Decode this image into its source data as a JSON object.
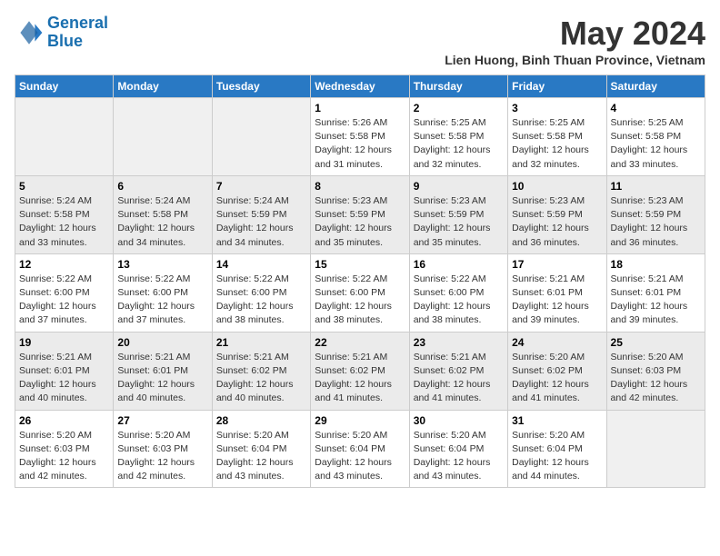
{
  "header": {
    "logo_line1": "General",
    "logo_line2": "Blue",
    "month_title": "May 2024",
    "subtitle": "Lien Huong, Binh Thuan Province, Vietnam"
  },
  "weekdays": [
    "Sunday",
    "Monday",
    "Tuesday",
    "Wednesday",
    "Thursday",
    "Friday",
    "Saturday"
  ],
  "weeks": [
    [
      {
        "day": "",
        "info": ""
      },
      {
        "day": "",
        "info": ""
      },
      {
        "day": "",
        "info": ""
      },
      {
        "day": "1",
        "info": "Sunrise: 5:26 AM\nSunset: 5:58 PM\nDaylight: 12 hours\nand 31 minutes."
      },
      {
        "day": "2",
        "info": "Sunrise: 5:25 AM\nSunset: 5:58 PM\nDaylight: 12 hours\nand 32 minutes."
      },
      {
        "day": "3",
        "info": "Sunrise: 5:25 AM\nSunset: 5:58 PM\nDaylight: 12 hours\nand 32 minutes."
      },
      {
        "day": "4",
        "info": "Sunrise: 5:25 AM\nSunset: 5:58 PM\nDaylight: 12 hours\nand 33 minutes."
      }
    ],
    [
      {
        "day": "5",
        "info": "Sunrise: 5:24 AM\nSunset: 5:58 PM\nDaylight: 12 hours\nand 33 minutes."
      },
      {
        "day": "6",
        "info": "Sunrise: 5:24 AM\nSunset: 5:58 PM\nDaylight: 12 hours\nand 34 minutes."
      },
      {
        "day": "7",
        "info": "Sunrise: 5:24 AM\nSunset: 5:59 PM\nDaylight: 12 hours\nand 34 minutes."
      },
      {
        "day": "8",
        "info": "Sunrise: 5:23 AM\nSunset: 5:59 PM\nDaylight: 12 hours\nand 35 minutes."
      },
      {
        "day": "9",
        "info": "Sunrise: 5:23 AM\nSunset: 5:59 PM\nDaylight: 12 hours\nand 35 minutes."
      },
      {
        "day": "10",
        "info": "Sunrise: 5:23 AM\nSunset: 5:59 PM\nDaylight: 12 hours\nand 36 minutes."
      },
      {
        "day": "11",
        "info": "Sunrise: 5:23 AM\nSunset: 5:59 PM\nDaylight: 12 hours\nand 36 minutes."
      }
    ],
    [
      {
        "day": "12",
        "info": "Sunrise: 5:22 AM\nSunset: 6:00 PM\nDaylight: 12 hours\nand 37 minutes."
      },
      {
        "day": "13",
        "info": "Sunrise: 5:22 AM\nSunset: 6:00 PM\nDaylight: 12 hours\nand 37 minutes."
      },
      {
        "day": "14",
        "info": "Sunrise: 5:22 AM\nSunset: 6:00 PM\nDaylight: 12 hours\nand 38 minutes."
      },
      {
        "day": "15",
        "info": "Sunrise: 5:22 AM\nSunset: 6:00 PM\nDaylight: 12 hours\nand 38 minutes."
      },
      {
        "day": "16",
        "info": "Sunrise: 5:22 AM\nSunset: 6:00 PM\nDaylight: 12 hours\nand 38 minutes."
      },
      {
        "day": "17",
        "info": "Sunrise: 5:21 AM\nSunset: 6:01 PM\nDaylight: 12 hours\nand 39 minutes."
      },
      {
        "day": "18",
        "info": "Sunrise: 5:21 AM\nSunset: 6:01 PM\nDaylight: 12 hours\nand 39 minutes."
      }
    ],
    [
      {
        "day": "19",
        "info": "Sunrise: 5:21 AM\nSunset: 6:01 PM\nDaylight: 12 hours\nand 40 minutes."
      },
      {
        "day": "20",
        "info": "Sunrise: 5:21 AM\nSunset: 6:01 PM\nDaylight: 12 hours\nand 40 minutes."
      },
      {
        "day": "21",
        "info": "Sunrise: 5:21 AM\nSunset: 6:02 PM\nDaylight: 12 hours\nand 40 minutes."
      },
      {
        "day": "22",
        "info": "Sunrise: 5:21 AM\nSunset: 6:02 PM\nDaylight: 12 hours\nand 41 minutes."
      },
      {
        "day": "23",
        "info": "Sunrise: 5:21 AM\nSunset: 6:02 PM\nDaylight: 12 hours\nand 41 minutes."
      },
      {
        "day": "24",
        "info": "Sunrise: 5:20 AM\nSunset: 6:02 PM\nDaylight: 12 hours\nand 41 minutes."
      },
      {
        "day": "25",
        "info": "Sunrise: 5:20 AM\nSunset: 6:03 PM\nDaylight: 12 hours\nand 42 minutes."
      }
    ],
    [
      {
        "day": "26",
        "info": "Sunrise: 5:20 AM\nSunset: 6:03 PM\nDaylight: 12 hours\nand 42 minutes."
      },
      {
        "day": "27",
        "info": "Sunrise: 5:20 AM\nSunset: 6:03 PM\nDaylight: 12 hours\nand 42 minutes."
      },
      {
        "day": "28",
        "info": "Sunrise: 5:20 AM\nSunset: 6:04 PM\nDaylight: 12 hours\nand 43 minutes."
      },
      {
        "day": "29",
        "info": "Sunrise: 5:20 AM\nSunset: 6:04 PM\nDaylight: 12 hours\nand 43 minutes."
      },
      {
        "day": "30",
        "info": "Sunrise: 5:20 AM\nSunset: 6:04 PM\nDaylight: 12 hours\nand 43 minutes."
      },
      {
        "day": "31",
        "info": "Sunrise: 5:20 AM\nSunset: 6:04 PM\nDaylight: 12 hours\nand 44 minutes."
      },
      {
        "day": "",
        "info": ""
      }
    ]
  ]
}
